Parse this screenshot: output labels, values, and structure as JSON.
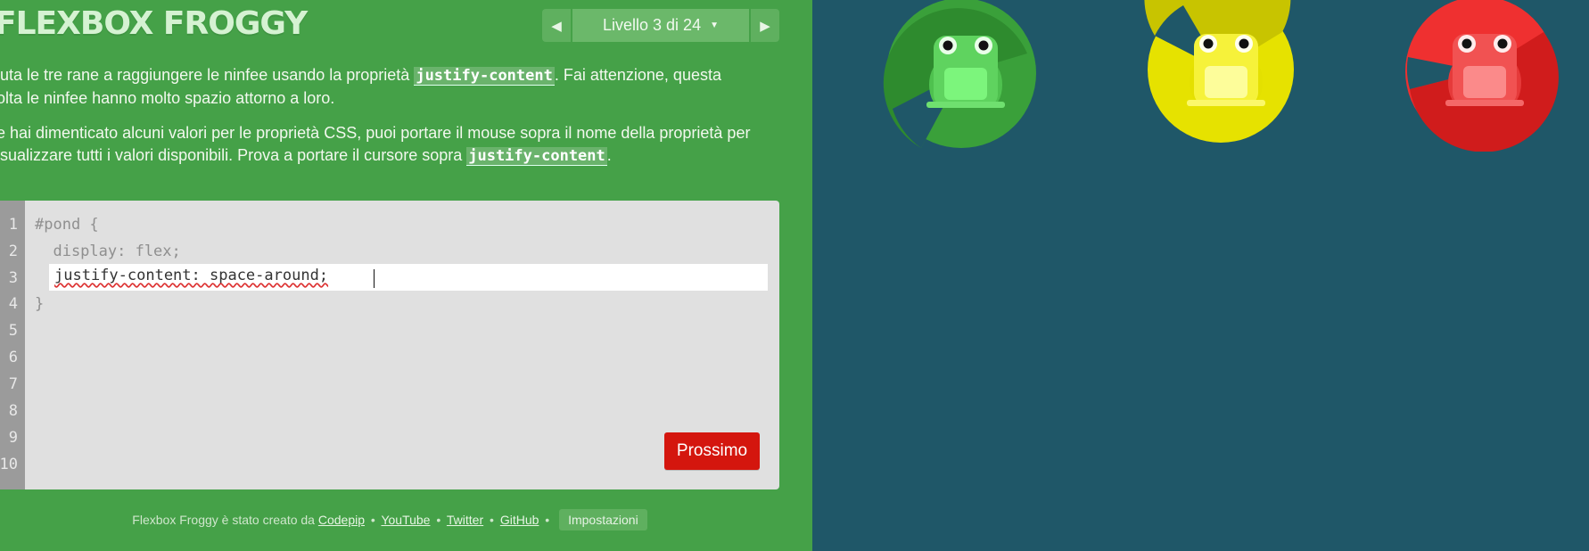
{
  "app": {
    "title": "FLEXBOX FROGGY"
  },
  "level_nav": {
    "prev_icon": "triangle-left-icon",
    "next_icon": "triangle-right-icon",
    "label": "Livello 3 di 24",
    "dropdown_icon": "caret-down-icon"
  },
  "instructions": {
    "p1_before": "iuta le tre rane a raggiungere le ninfee usando la proprietà ",
    "p1_code": "justify-content",
    "p1_after_line1": ". Fai attenzione, questa",
    "p1_line2": "olta le ninfee hanno molto spazio attorno a loro.",
    "p2_line1": "e hai dimenticato alcuni valori per le proprietà CSS, puoi portare il mouse sopra il nome della proprietà per",
    "p2_line2_before": "isualizzare tutti i valori disponibili. Prova a portare il cursore sopra ",
    "p2_code": "justify-content",
    "p2_after": "."
  },
  "editor": {
    "line_numbers": [
      "1",
      "2",
      "3",
      "4",
      "5",
      "6",
      "7",
      "8",
      "9",
      "10"
    ],
    "line1": "#pond {",
    "line2": "  display: flex;",
    "input_value": "justify-content: space-around;",
    "line4": "}",
    "next_label": "Prossimo"
  },
  "footer": {
    "credit": "Flexbox Froggy è stato creato da",
    "links": [
      "Codepip",
      "YouTube",
      "Twitter",
      "GitHub"
    ],
    "separator": "•",
    "settings_label": "Impostazioni"
  },
  "pond": {
    "frogs": [
      {
        "color": "green",
        "pad": "#2e8b2e",
        "body": "#5fd35f"
      },
      {
        "color": "yellow",
        "pad": "#c8c400",
        "body": "#f6f23a"
      },
      {
        "color": "red",
        "pad": "#d01c1c",
        "body": "#f15252"
      }
    ]
  },
  "colors": {
    "sidebar": "#45a148",
    "pond": "#1f5768",
    "button": "#d4160e"
  }
}
